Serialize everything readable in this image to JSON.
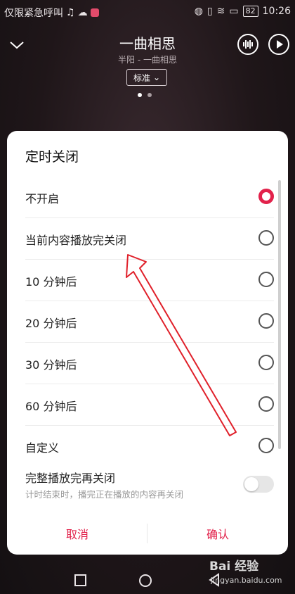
{
  "status_bar": {
    "carrier": "仅限紧急呼叫",
    "battery": "82",
    "time": "10:26"
  },
  "player": {
    "title": "一曲相思",
    "subtitle": "半阳 - 一曲相思",
    "quality": "标准"
  },
  "dialog": {
    "title": "定时关闭",
    "options": [
      {
        "label": "不开启",
        "selected": true
      },
      {
        "label": "当前内容播放完关闭",
        "selected": false
      },
      {
        "label": "10 分钟后",
        "selected": false
      },
      {
        "label": "20 分钟后",
        "selected": false
      },
      {
        "label": "30 分钟后",
        "selected": false
      },
      {
        "label": "60 分钟后",
        "selected": false
      },
      {
        "label": "自定义",
        "selected": false
      }
    ],
    "toggle": {
      "title": "完整播放完再关闭",
      "description": "计时结束时，播完正在播放的内容再关闭",
      "on": false
    },
    "cancel_label": "取消",
    "confirm_label": "确认"
  },
  "watermark": {
    "brand": "Bai 经验",
    "url": "jingyan.baidu.com"
  },
  "colors": {
    "accent": "#e2224b",
    "background": "#1a1317"
  }
}
